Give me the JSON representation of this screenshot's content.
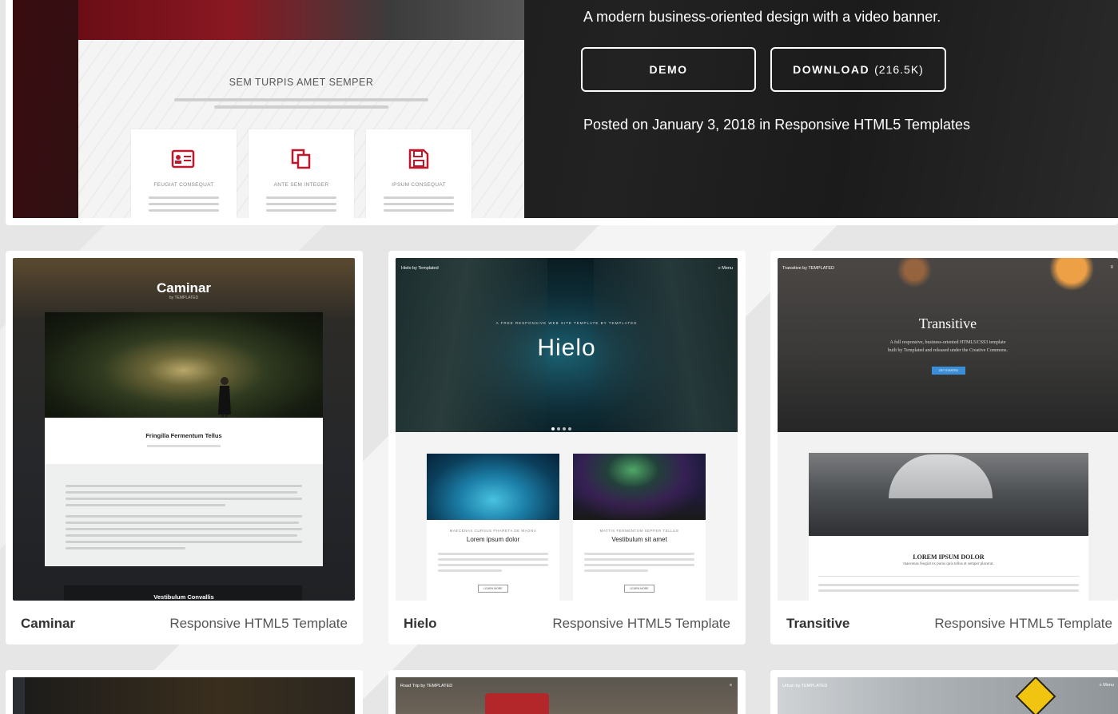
{
  "featured": {
    "description": "A modern business-oriented design with a video banner.",
    "demo_label": "DEMO",
    "download_label": "DOWNLOAD",
    "download_size": "(216.5K)",
    "posted_prefix": "Posted on",
    "posted_date": "January 3, 2018",
    "posted_in": "in",
    "posted_category": "Responsive HTML5 Templates",
    "preview": {
      "heading": "SEM TURPIS AMET SEMPER",
      "boxes": [
        {
          "icon": "id-card-icon",
          "caption": "FEUGIAT CONSEQUAT"
        },
        {
          "icon": "copy-icon",
          "caption": "ANTE SEM INTEGER"
        },
        {
          "icon": "floppy-disk-icon",
          "caption": "IPSUM CONSEQUAT"
        }
      ]
    }
  },
  "cards": [
    {
      "name": "Caminar",
      "kind": "Responsive HTML5 Template",
      "preview": {
        "title": "Caminar",
        "by": "by TEMPLATED",
        "section_title": "Fringilla Fermentum Tellus",
        "footer_title": "Vestibulum Convallis"
      }
    },
    {
      "name": "Hielo",
      "kind": "Responsive HTML5 Template",
      "preview": {
        "brand": "Hielo by Templated",
        "menu": "≡ Menu",
        "kicker": "A FREE RESPONSIVE WEB SITE TEMPLATE BY TEMPLATED",
        "title": "Hielo",
        "col1_kicker": "MAECENAS CURSUS PHARETA DE MAGNA",
        "col1_title": "Lorem ipsum dolor",
        "col2_kicker": "MATTIS FERMENTUM SEPPER TELLUS",
        "col2_title": "Vestibulum sit amet",
        "more": "LEARN MORE"
      }
    },
    {
      "name": "Transitive",
      "kind": "Responsive HTML5 Template",
      "preview": {
        "brand": "Transitive by TEMPLATED",
        "title": "Transitive",
        "subtitle_1": "A full responsive, business-oriented HTML5/CSS3 template",
        "subtitle_2": "built by Templated and released under the Creative Commons.",
        "button": "GET STARTED",
        "section_title": "LOREM IPSUM DOLOR",
        "section_sub": "maecenas feugiat ex purus quis tellus et semper placerat."
      }
    }
  ],
  "bottom_row": [
    {
      "top_left": "",
      "top_right": ""
    },
    {
      "top_left": "Road Trip by TEMPLATED",
      "top_right": "≡"
    },
    {
      "top_left": "Urban by TEMPLATED",
      "top_right": "≡ Menu"
    }
  ],
  "colors": {
    "accent_red": "#c0182a",
    "page_bg": "#e6e6e6",
    "card_bg": "#ffffff"
  }
}
